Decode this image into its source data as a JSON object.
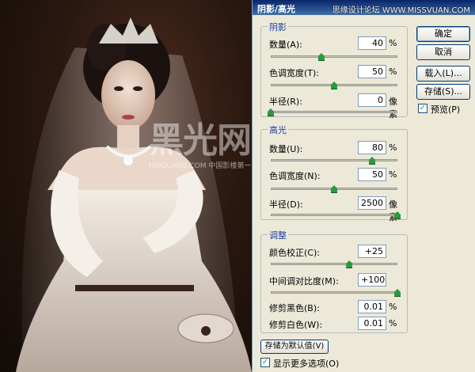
{
  "site_watermark": "思缘设计论坛 WWW.MISSVUAN.COM",
  "photo": {
    "watermark_logo": "黑光网",
    "watermark_sub": "HEIGUANG.COM 中国影楼第一门户"
  },
  "dialog": {
    "title": "阴影/高光",
    "shadows": {
      "title": "阴影",
      "amount": {
        "label": "数量(A):",
        "value": "40",
        "unit": "%",
        "level": 0.4
      },
      "tonal_width": {
        "label": "色调宽度(T):",
        "value": "50",
        "unit": "%",
        "level": 0.5
      },
      "radius": {
        "label": "半径(R):",
        "value": "0",
        "unit": "像素",
        "level": 0.0
      }
    },
    "highlights": {
      "title": "高光",
      "amount": {
        "label": "数量(U):",
        "value": "80",
        "unit": "%",
        "level": 0.8
      },
      "tonal_width": {
        "label": "色调宽度(N):",
        "value": "50",
        "unit": "%",
        "level": 0.5
      },
      "radius": {
        "label": "半径(D):",
        "value": "2500",
        "unit": "像素",
        "level": 1.0
      }
    },
    "adjustments": {
      "title": "调整",
      "color_correction": {
        "label": "颜色校正(C):",
        "value": "+25",
        "level": 0.62
      },
      "midtone_contrast": {
        "label": "中间调对比度(M):",
        "value": "+100",
        "level": 1.0
      },
      "black_clip": {
        "label": "修剪黑色(B):",
        "value": "0.01",
        "unit": "%"
      },
      "white_clip": {
        "label": "修剪白色(W):",
        "value": "0.01",
        "unit": "%"
      }
    },
    "buttons": {
      "ok": "确定",
      "cancel": "取消",
      "load": "载入(L)...",
      "save": "存储(S)...",
      "save_default": "存储为默认值(V)"
    },
    "preview": {
      "label": "预览(P)",
      "checked": true
    },
    "more_options": {
      "label": "显示更多选项(O)",
      "checked": true
    }
  }
}
